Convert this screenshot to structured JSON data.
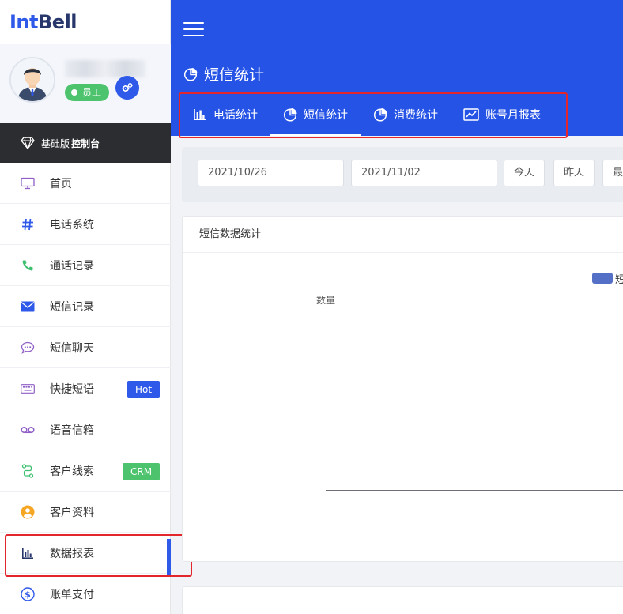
{
  "brand": {
    "part1": "Int",
    "part2": "Bell"
  },
  "profile": {
    "role_badge": "员工"
  },
  "plan": {
    "edition": "基础版",
    "console": "控制台"
  },
  "sidebar": {
    "items": [
      {
        "label": "首页",
        "icon": "monitor-icon"
      },
      {
        "label": "电话系统",
        "icon": "hash-icon"
      },
      {
        "label": "通话记录",
        "icon": "phone-icon"
      },
      {
        "label": "短信记录",
        "icon": "envelope-icon"
      },
      {
        "label": "短信聊天",
        "icon": "chat-bubble-icon"
      },
      {
        "label": "快捷短语",
        "icon": "keyboard-icon",
        "tag": "Hot"
      },
      {
        "label": "语音信箱",
        "icon": "voicemail-icon"
      },
      {
        "label": "客户线索",
        "icon": "route-icon",
        "tag": "CRM"
      },
      {
        "label": "客户资料",
        "icon": "user-circle-icon"
      },
      {
        "label": "数据报表",
        "icon": "bar-chart-icon",
        "active": true
      },
      {
        "label": "账单支付",
        "icon": "dollar-circle-icon"
      }
    ]
  },
  "header": {
    "page_title": "短信统计",
    "tabs": [
      {
        "label": "电话统计",
        "icon": "bar-chart-icon"
      },
      {
        "label": "短信统计",
        "icon": "pie-chart-icon",
        "active": true
      },
      {
        "label": "消费统计",
        "icon": "pie-chart-icon"
      },
      {
        "label": "账号月报表",
        "icon": "line-chart-icon"
      }
    ]
  },
  "filters": {
    "start_date": "2021/10/26",
    "end_date": "2021/11/02",
    "quick_today": "今天",
    "quick_yesterday": "昨天",
    "quick_recent": "最"
  },
  "chart_card": {
    "title": "短信数据统计",
    "legend_text": "短",
    "y_axis_label": "数量"
  },
  "colors": {
    "primary": "#2553e6",
    "success": "#4dc36d",
    "dark_bar": "#2c2d30",
    "highlight_red": "#e3262b",
    "legend_series": "#5470c6"
  }
}
